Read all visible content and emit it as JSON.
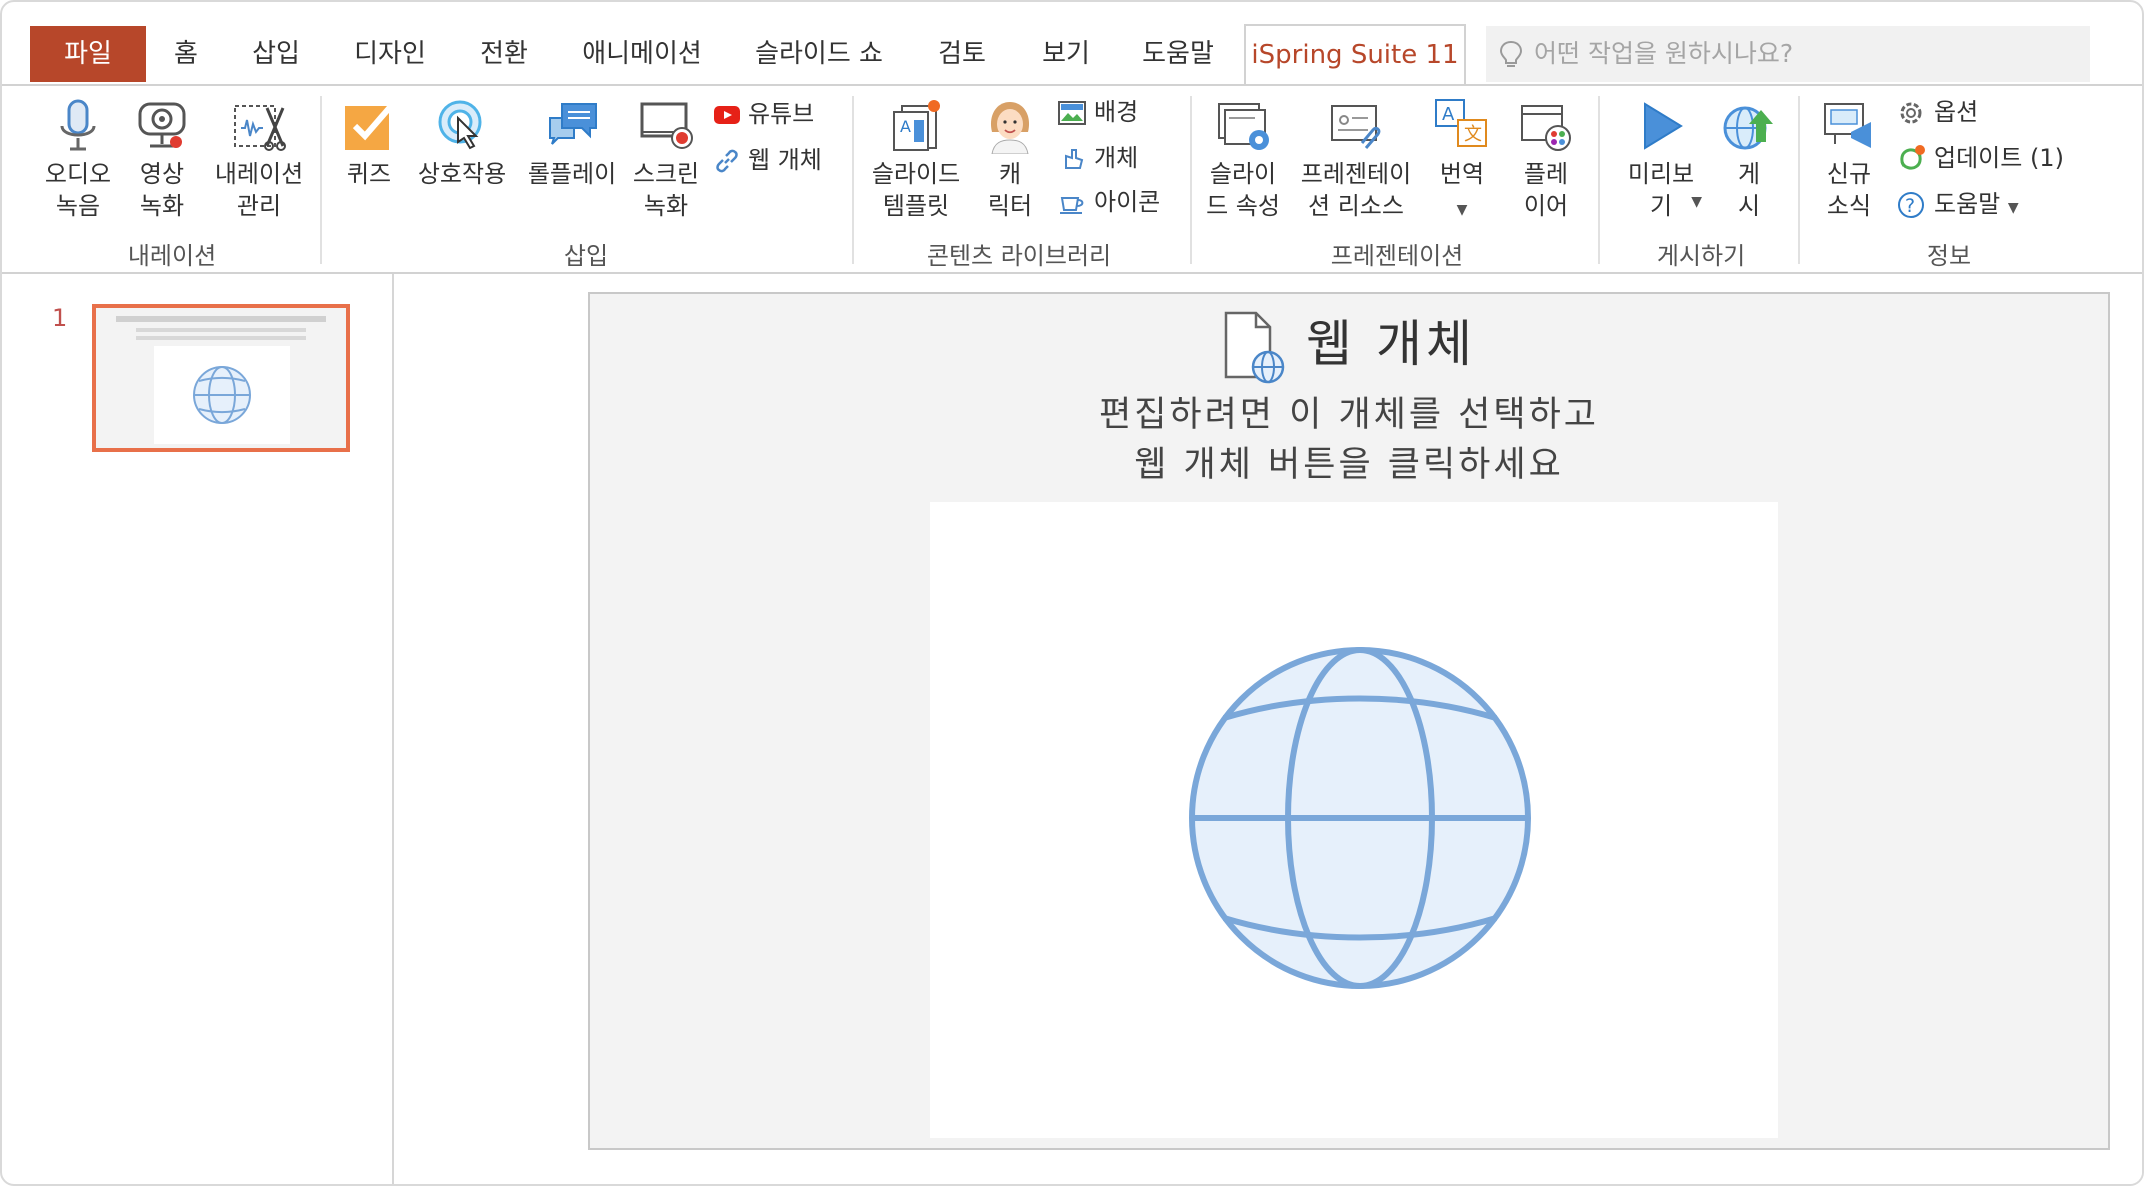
{
  "tabs": {
    "file": "파일",
    "items": [
      "홈",
      "삽입",
      "디자인",
      "전환",
      "애니메이션",
      "슬라이드 쇼",
      "검토",
      "보기",
      "도움말"
    ],
    "active": "iSpring Suite 11",
    "search_placeholder": "어떤 작업을 원하시나요?"
  },
  "ribbon": {
    "narration": {
      "audio": "오디오\n녹음",
      "video": "영상\n녹화",
      "manage": "내레이션\n관리",
      "group": "내레이션"
    },
    "insert": {
      "quiz": "퀴즈",
      "interaction": "상호작용",
      "roleplay": "롤플레이",
      "screen": "스크린\n녹화",
      "youtube": "유튜브",
      "web_object": "웹 개체",
      "group": "삽입"
    },
    "content": {
      "slide_template": "슬라이드\n템플릿",
      "character": "캐\n릭터",
      "background": "배경",
      "object": "개체",
      "icon": "아이콘",
      "group": "콘텐츠 라이브러리"
    },
    "presentation": {
      "slide_props": "슬라이\n드 속성",
      "resources": "프레젠테이\n션 리소스",
      "translate": "번역",
      "player": "플레\n이어",
      "group": "프레젠테이션"
    },
    "publish": {
      "preview": "미리보\n기",
      "publish": "게\n시",
      "group": "게시하기"
    },
    "info": {
      "news": "신규\n소식",
      "options": "옵션",
      "update": "업데이트 (1)",
      "help": "도움말",
      "group": "정보"
    }
  },
  "slides_panel": {
    "number": "1"
  },
  "slide": {
    "title": "웹 개체",
    "line1": "편집하려면 이 개체를 선택하고",
    "line2": "웹 개체 버튼을 클릭하세요"
  },
  "colors": {
    "file_tab": "#b7472a",
    "active_tab_text": "#b7472a",
    "thumb_border": "#e8704a",
    "globe_stroke": "#7aa7d9",
    "globe_fill": "#e6f0fb"
  }
}
